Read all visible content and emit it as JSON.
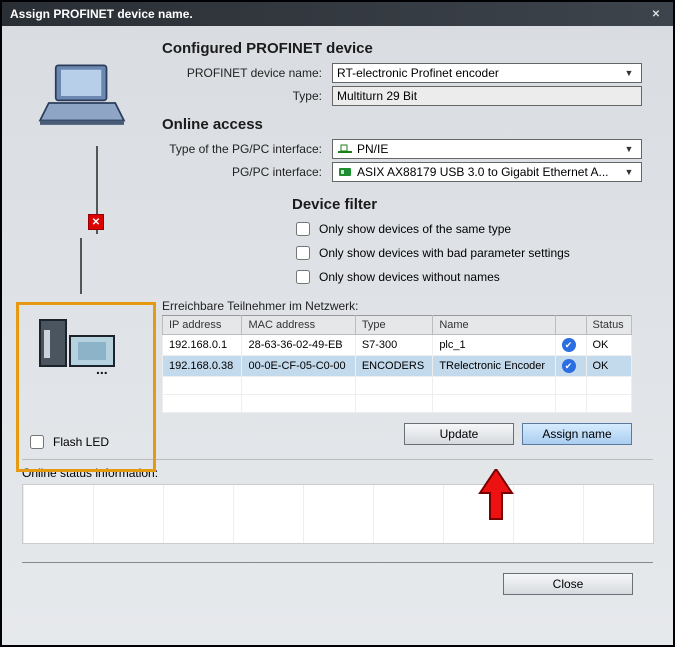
{
  "title": "Assign PROFINET device name.",
  "configured": {
    "heading": "Configured PROFINET device",
    "name_label": "PROFINET device name:",
    "name_value": "RT-electronic Profinet encoder",
    "type_label": "Type:",
    "type_value": "Multiturn 29 Bit"
  },
  "online": {
    "heading": "Online access",
    "pgpc_type_label": "Type of the PG/PC interface:",
    "pgpc_type_value": "PN/IE",
    "pgpc_if_label": "PG/PC interface:",
    "pgpc_if_value": "ASIX AX88179 USB 3.0 to Gigabit Ethernet A..."
  },
  "filter": {
    "heading": "Device filter",
    "opt1": "Only show devices of the same type",
    "opt2": "Only show devices with bad parameter settings",
    "opt3": "Only show devices without names"
  },
  "flash_led": "Flash LED",
  "table": {
    "caption": "Erreichbare Teilnehmer im Netzwerk:",
    "cols": {
      "ip": "IP address",
      "mac": "MAC address",
      "type": "Type",
      "name": "Name",
      "status": "Status"
    },
    "rows": [
      {
        "ip": "192.168.0.1",
        "mac": "28-63-36-02-49-EB",
        "type": "S7-300",
        "name": "plc_1",
        "status": "OK"
      },
      {
        "ip": "192.168.0.38",
        "mac": "00-0E-CF-05-C0-00",
        "type": "ENCODERS",
        "name": "TRelectronic Encoder",
        "status": "OK"
      }
    ]
  },
  "buttons": {
    "update": "Update",
    "assign": "Assign name",
    "close": "Close"
  },
  "status": {
    "heading": "Online status information:"
  }
}
